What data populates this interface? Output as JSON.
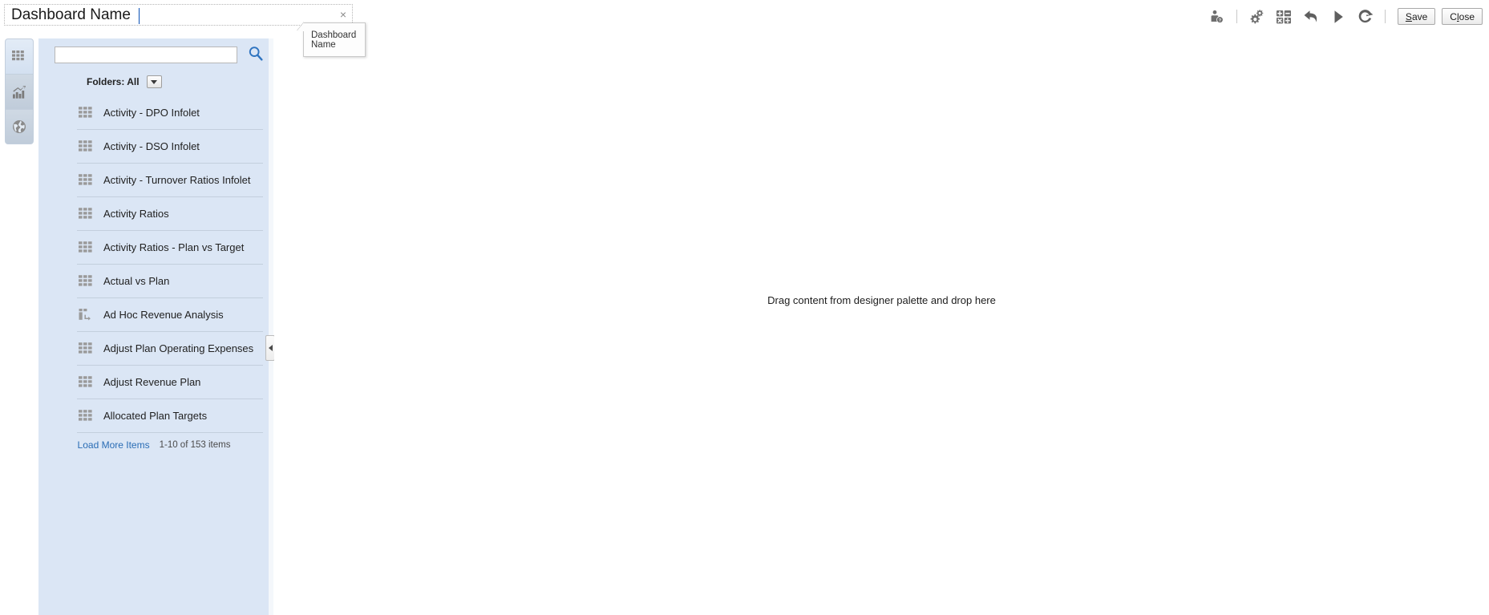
{
  "titlebar": {
    "dashboard_name_value": "Dashboard Name",
    "dashboard_name_placeholder": "Dashboard Name",
    "clear_glyph": "×"
  },
  "tooltip": {
    "line1": "Dashboard",
    "line2": "Name"
  },
  "toolbar": {
    "icons": [
      {
        "name": "user-assign-icon",
        "title": "Assign Users"
      },
      {
        "name": "settings-gear-icon",
        "title": "Settings"
      },
      {
        "name": "calculator-grid-icon",
        "title": "Calculation"
      },
      {
        "name": "undo-icon",
        "title": "Undo"
      },
      {
        "name": "run-play-icon",
        "title": "Run"
      },
      {
        "name": "refresh-icon",
        "title": "Refresh"
      }
    ],
    "save_label": "Save",
    "save_accel": "S",
    "save_rest": "ave",
    "close_pre": "C",
    "close_accel": "l",
    "close_rest": "ose",
    "close_label": "Close"
  },
  "rail": {
    "tabs": [
      {
        "name": "rail-tab-forms",
        "icon": "grid-icon",
        "active": true
      },
      {
        "name": "rail-tab-charts",
        "icon": "bar-chart-trend-icon",
        "active": false
      },
      {
        "name": "rail-tab-external",
        "icon": "globe-icon",
        "active": false
      }
    ]
  },
  "palette": {
    "search_value": "",
    "search_placeholder": "",
    "search_icon": "search-icon",
    "folders_label": "Folders: All",
    "folders_dropdown_icon": "chevron-down-icon",
    "items": [
      {
        "label": "Activity - DPO Infolet",
        "icon": "grid-icon"
      },
      {
        "label": "Activity - DSO Infolet",
        "icon": "grid-icon"
      },
      {
        "label": "Activity - Turnover Ratios Infolet",
        "icon": "grid-icon"
      },
      {
        "label": "Activity Ratios",
        "icon": "grid-icon"
      },
      {
        "label": "Activity Ratios - Plan vs Target",
        "icon": "grid-icon"
      },
      {
        "label": "Actual vs Plan",
        "icon": "grid-icon"
      },
      {
        "label": "Ad Hoc Revenue Analysis",
        "icon": "adhoc-grid-icon"
      },
      {
        "label": "Adjust Plan Operating Expenses",
        "icon": "grid-icon"
      },
      {
        "label": "Adjust Revenue Plan",
        "icon": "grid-icon"
      },
      {
        "label": "Allocated Plan Targets",
        "icon": "grid-icon"
      }
    ],
    "load_more_label": "Load More Items",
    "count_text": "1-10 of 153 items"
  },
  "canvas": {
    "dropzone_text": "Drag content from designer palette and drop here"
  },
  "splitter": {
    "collapse_icon": "collapse-left-icon"
  },
  "colors": {
    "panel_bg": "#dbe6f5",
    "link": "#2a6db5",
    "search_icon": "#2f74c0",
    "icon_gray": "#8a8a8a",
    "separator": "#c3cfdd"
  }
}
